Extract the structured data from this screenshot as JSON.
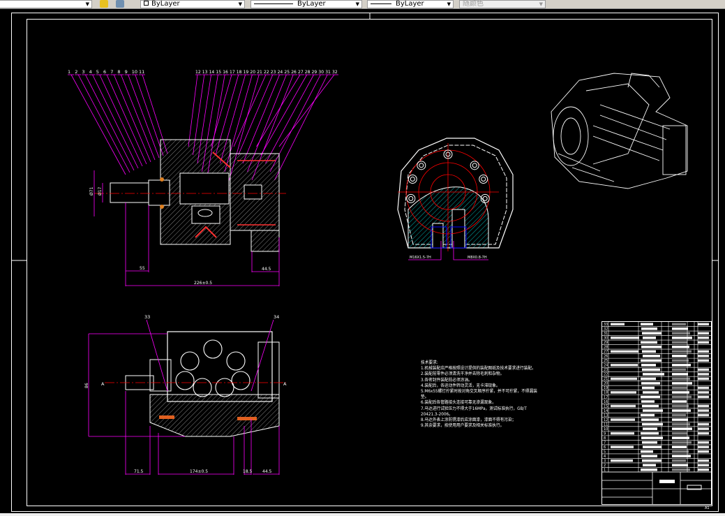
{
  "toolbar": {
    "layer_color": "ByLayer",
    "linetype": "ByLayer",
    "lineweight": "ByLayer",
    "plot_style": "随颜色"
  },
  "drawing": {
    "colors": {
      "outline": "#ffffff",
      "leader": "#ff00ff",
      "centerline": "#ff0000",
      "hatch": "#00ffff",
      "hidden": "#0000ff"
    },
    "balloons_left": [
      "1",
      "2",
      "3",
      "4",
      "5",
      "6",
      "7",
      "8",
      "9",
      "10",
      "11"
    ],
    "balloons_right": [
      "12",
      "13",
      "14",
      "15",
      "16",
      "17",
      "18",
      "19",
      "20",
      "21",
      "22",
      "23",
      "24",
      "25",
      "26",
      "27",
      "28",
      "29",
      "30",
      "31",
      "32"
    ],
    "balloons_bottom": [
      "33",
      "34"
    ],
    "dims_section": {
      "left": "55",
      "right": "44.5",
      "overall": "226±0.5",
      "dia_outer": "Ø71",
      "dia_inner": "Ø17"
    },
    "dims_bottom": {
      "left": "71.5",
      "middle": "174±0.5",
      "small": "18.5",
      "right": "44.5",
      "height": "86"
    },
    "thread_labels": [
      "M16X1.5-7H",
      "M8X0.8-7H"
    ],
    "section_marks": [
      "A",
      "A"
    ],
    "sheet_size": "A1"
  },
  "tech_requirements": {
    "title": "技术要求:",
    "items": [
      "1.机械装配应严格按照设计提供的装配图纸及技术要求进行装配。",
      "2.装配前零件必须清洗干净并去除毛刺和杂物。",
      "3.各密封件装配前必须涂油。",
      "4.装配后，各运动件转动灵活，无卡滞现象。",
      "5.M6x55螺钉拧紧时按对角交叉顺序拧紧，并不可拧紧，不得漏装",
      "垫。",
      "6.装配后各管路接头连接可靠无渗漏现象。",
      "7.马达进行试验压力不得大于16MPa，测试标准执行，GB/T",
      "20421.3-2006。",
      "8.马达外表上涂防锈漆后应涂面漆，漆面不得有污染；",
      "9.其余要求，按使用用户要求及相关标准执行。"
    ]
  },
  "parts_list": {
    "rows": [
      "33",
      "32",
      "31",
      "30",
      "29",
      "28",
      "27",
      "26",
      "25",
      "24",
      "23",
      "22",
      "21",
      "20",
      "19",
      "18",
      "17",
      "16",
      "15",
      "14",
      "13",
      "12",
      "11",
      "10",
      "9",
      "8",
      "7",
      "6",
      "5",
      "4",
      "3",
      "2",
      "1"
    ]
  }
}
